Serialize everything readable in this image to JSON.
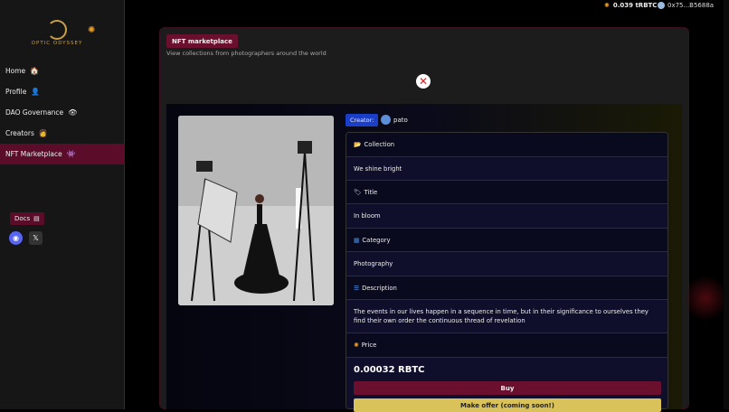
{
  "logo": {
    "text": "OPTIC ODYSSEY"
  },
  "topbar": {
    "balance": "0.039 tRBTC",
    "address": "0x75...B5688a"
  },
  "sidebar": {
    "items": [
      {
        "label": "Home",
        "icon": "house-icon",
        "glyph": "🏠"
      },
      {
        "label": "Profile",
        "icon": "user-icon",
        "glyph": "👤"
      },
      {
        "label": "DAO Governance",
        "icon": "governance-icon",
        "glyph": "👁"
      },
      {
        "label": "Creators",
        "icon": "creators-icon",
        "glyph": "👩"
      },
      {
        "label": "NFT Marketplace",
        "icon": "marketplace-icon",
        "glyph": "👾"
      }
    ],
    "docs_label": "Docs"
  },
  "header": {
    "tag": "NFT marketplace",
    "subtitle": "View collections from photographers around the world"
  },
  "creator": {
    "label": "Creator:",
    "name": "pato"
  },
  "details": {
    "collection_label": "Collection",
    "collection_value": "We shine bright",
    "title_label": "Title",
    "title_value": "In bloom",
    "category_label": "Category",
    "category_value": "Photography",
    "description_label": "Description",
    "description_value": "The events in our lives happen in a sequence in time, but in their significance to ourselves they find their own order the continuous thread of revelation",
    "price_label": "Price",
    "price_value": "0.00032 RBTC"
  },
  "buttons": {
    "buy": "Buy",
    "offer": "Make offer (coming soon!)"
  },
  "colors": {
    "accent": "#6a0f2e",
    "creator_tag": "#1b3ec8",
    "offer": "#d9c25a"
  }
}
